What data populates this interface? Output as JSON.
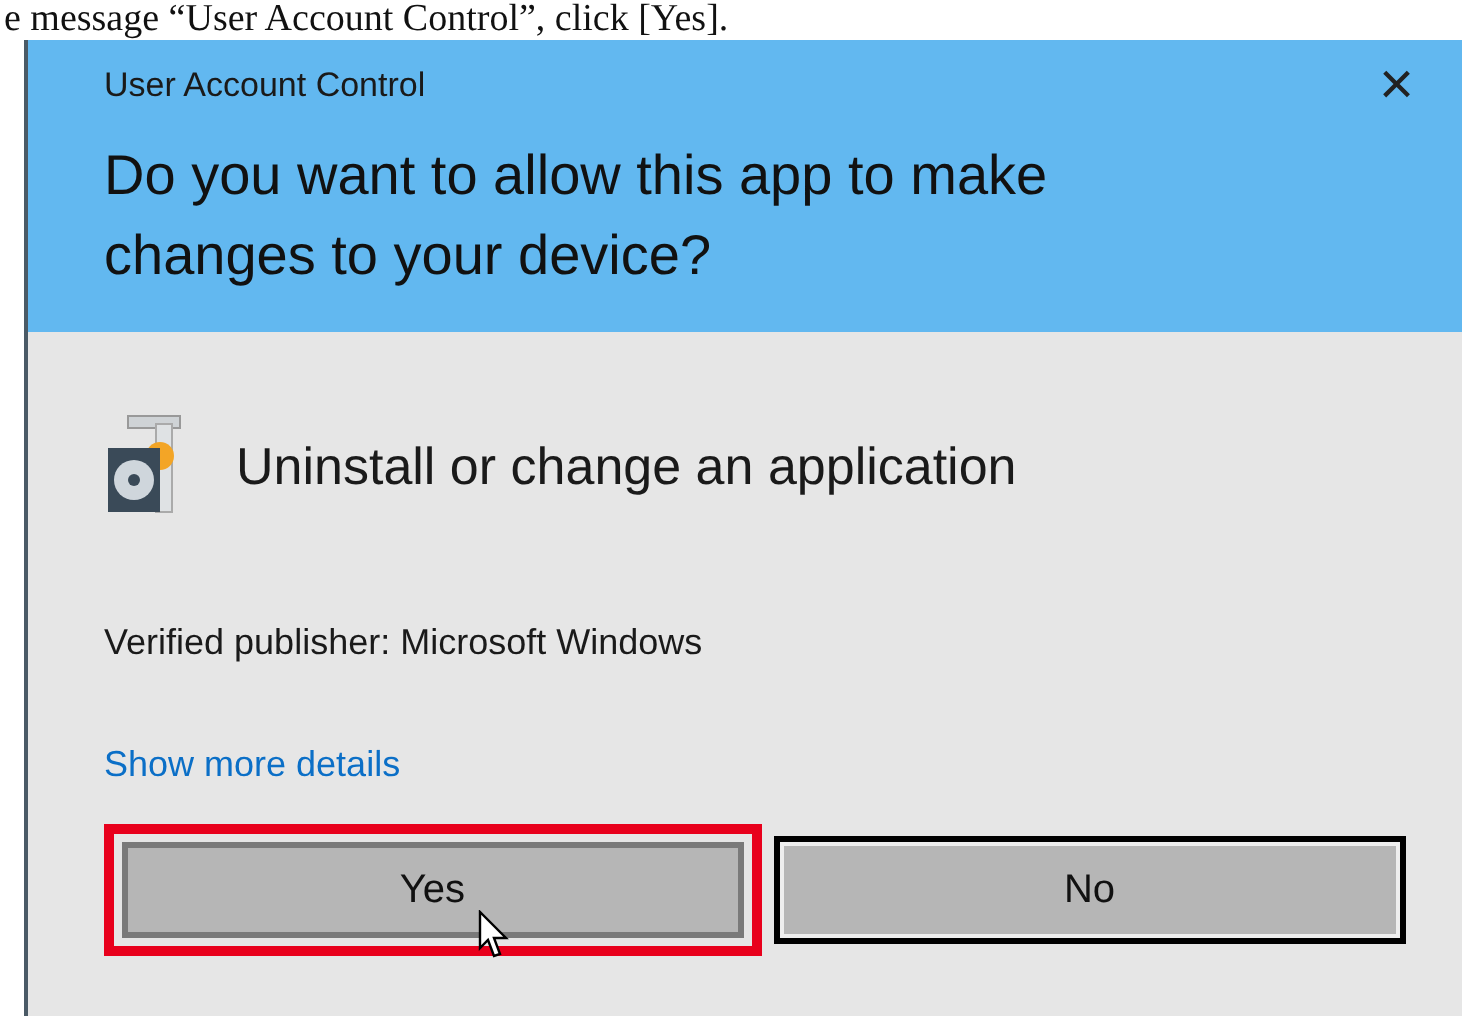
{
  "caption": "e message “User Account Control”, click [Yes].",
  "window": {
    "title": "User Account Control",
    "close": "×"
  },
  "question": "Do you want to allow this app to make changes to your device?",
  "app_name": "Uninstall or change an application",
  "publisher": "Verified publisher: Microsoft Windows",
  "details_link": "Show more details",
  "buttons": [
    {
      "label": "Yes",
      "focused": false,
      "highlighted": true,
      "hovered": true
    },
    {
      "label": "No",
      "focused": true,
      "highlighted": false,
      "hovered": false
    }
  ]
}
